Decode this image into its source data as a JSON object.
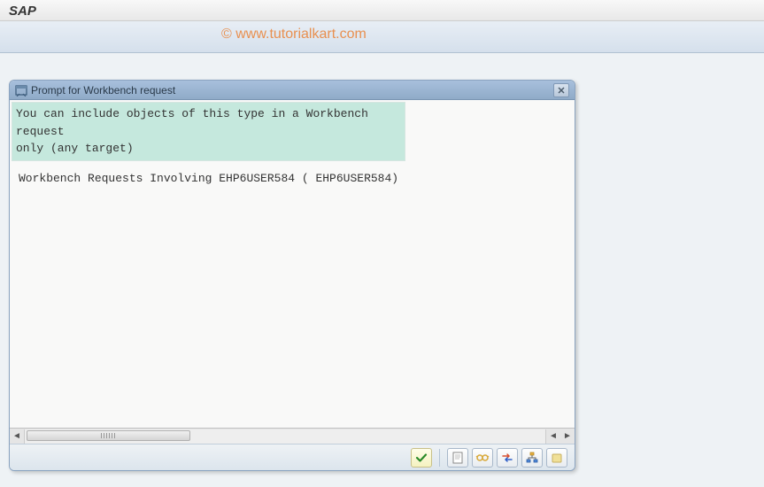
{
  "header": {
    "title": "SAP"
  },
  "watermark": "© www.tutorialkart.com",
  "dialog": {
    "title": "Prompt for Workbench request",
    "info_line1": "You can include objects of this type in a Workbench request",
    "info_line2": "only (any target)",
    "request_text": "Workbench Requests Involving EHP6USER584 ( EHP6USER584)"
  },
  "icons": {
    "dialog_window": "window-icon",
    "close": "close-icon",
    "accept": "check-icon",
    "create": "document-icon",
    "own_requests": "glasses-icon",
    "change_requests": "arrows-icon",
    "hierarchy": "hierarchy-icon",
    "cancel": "folder-icon"
  }
}
